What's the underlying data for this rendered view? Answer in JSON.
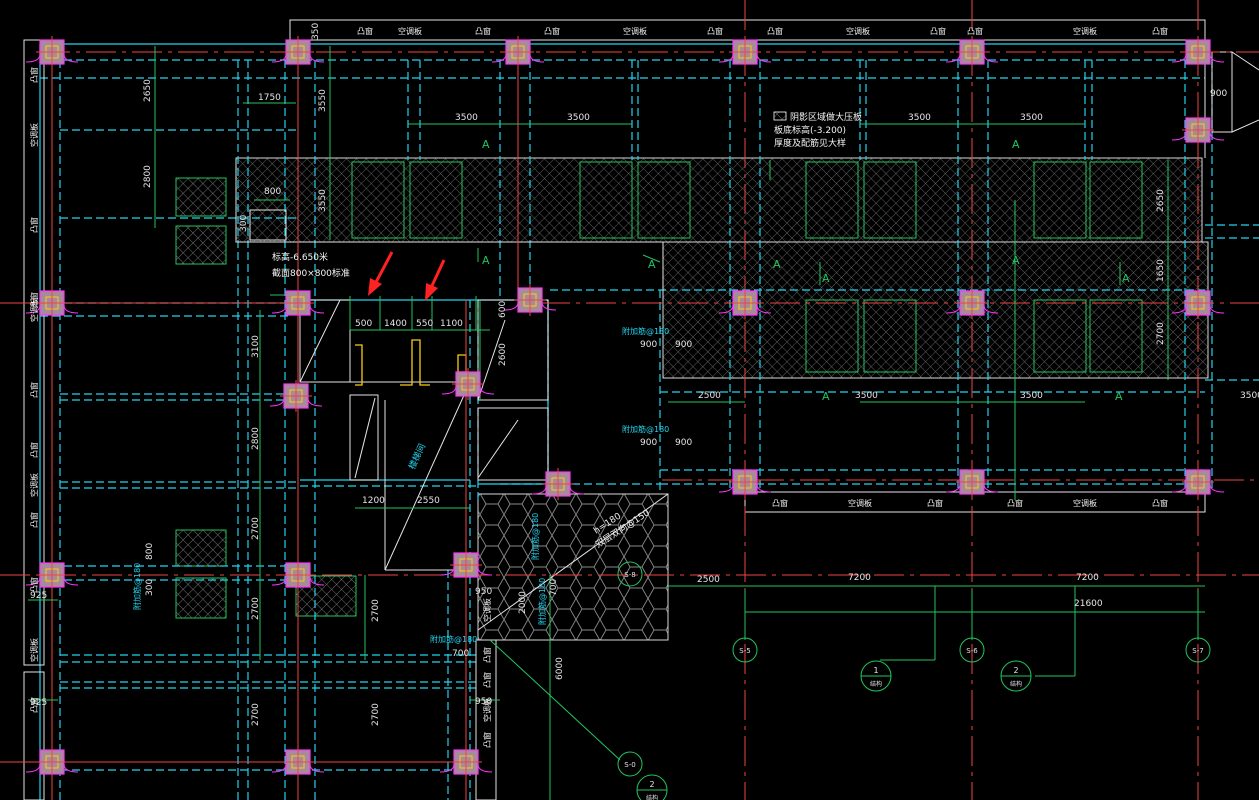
{
  "colors": {
    "background": "#000000",
    "grid_cyan": "#22d3ee",
    "dim_green": "#22c55e",
    "axis_red": "#ef4444",
    "column_magenta": "#ff33ff",
    "column_fill": "#a78b9a",
    "white": "#ffffff",
    "yellow": "#facc15",
    "arrow_red": "#ff2222"
  },
  "window_labels": {
    "top": [
      "凸窗",
      "空调板",
      "凸窗",
      "凸窗",
      "空调板",
      "凸窗",
      "凸窗",
      "空调板",
      "凸窗",
      "凸窗",
      "空调板",
      "凸窗"
    ],
    "bottom": [
      "凸窗",
      "空调板",
      "凸窗",
      "凸窗",
      "空调板",
      "凸窗"
    ],
    "left": [
      "凸窗",
      "空调板",
      "凸窗",
      "凸窗",
      "空调板",
      "凸窗",
      "凸窗",
      "空调板",
      "凸窗",
      "凸窗",
      "空调板",
      "凸窗"
    ],
    "middle": [
      "空调板",
      "凸窗",
      "凸窗",
      "空调板",
      "凸窗"
    ]
  },
  "dimensions": {
    "d350_top": "350",
    "d2650": "2650",
    "d1750": "1750",
    "d3550_a": "3550",
    "d2800_a": "2800",
    "d3550_b": "3550",
    "d3500_1": "3500",
    "d3500_2": "3500",
    "d3500_3": "3500",
    "d3500_4": "3500",
    "d3500_5": "3500",
    "d3500_6": "3500",
    "d3500_7": "3500",
    "d350_right": "350",
    "d2650_right": "2650",
    "d1650": "1650",
    "d2700_right": "2700",
    "d900_right": "900",
    "d2500": "2500",
    "d800": "800",
    "d300": "300",
    "d500": "500",
    "d1400": "1400",
    "d550": "550",
    "d1100": "1100",
    "d600": "600",
    "d3100": "3100",
    "d2600": "2600",
    "d2800_b": "2800",
    "d2700_a": "2700",
    "d2700_b": "2700",
    "d2700_c": "2700",
    "d2700_d": "2700",
    "d2700_e": "2700",
    "d1200": "1200",
    "d2550": "2550",
    "d925_a": "925",
    "d925_b": "925",
    "d950_a": "950",
    "d950_b": "950",
    "d6000": "6000",
    "d2000": "2000",
    "d700_a": "700",
    "d700_b": "700",
    "bottom_2500": "2500",
    "bottom_7200_a": "7200",
    "bottom_7200_b": "7200",
    "bottom_21600": "21600",
    "d900_a": "900",
    "d900_b": "900",
    "d900_c": "900",
    "d900_d": "900",
    "d900_e": "900",
    "d900_f": "900",
    "d800_v": "800",
    "d300_v": "300"
  },
  "notes": {
    "legend_1": "阴影区域做大压板",
    "legend_2": "板底标高(-3.200)",
    "legend_3": "厚度及配筋见大样",
    "elev": "标高-6.650米",
    "section": "截面800×800标准",
    "slab1": "h=180",
    "slab2": "双层双向@150",
    "rebar_1": "附加筋@180",
    "rebar_2": "附加筋@180",
    "rebar_3": "附加筋@180",
    "rebar_4": "附加筋@180",
    "rebar_5": "附加筋@180",
    "rebar_6": "附加筋@180",
    "stair": "楼梯间"
  },
  "tags": {
    "A": "A"
  },
  "axes": {
    "s5": "S-5",
    "s6": "S-6",
    "s7": "S-7",
    "s8": "S-8",
    "s0": "S-0",
    "detail1_num": "1",
    "detail1_sub": "结构",
    "detail2_num": "2",
    "detail2_sub": "结构",
    "detail3_num": "2",
    "detail3_sub": "结构"
  }
}
